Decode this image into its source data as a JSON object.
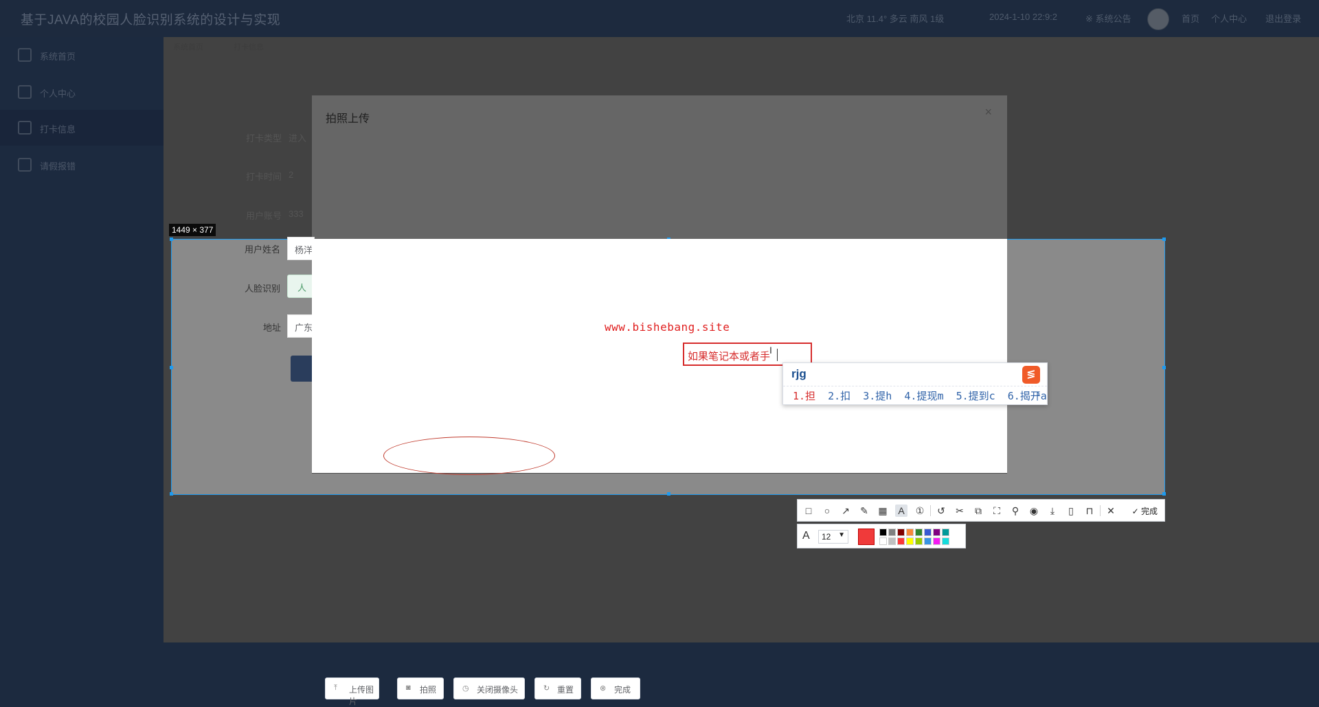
{
  "app": {
    "title": "基于JAVA的校园人脸识别系统的设计与实现",
    "weather": "北京  11.4°  多云  南风  1级",
    "datetime": "2024-1-10 22:9:2",
    "notice": "※ 系统公告",
    "nav": [
      "首页",
      "个人中心",
      "退出登录"
    ]
  },
  "sidebar": {
    "items": [
      {
        "label": "系统首页"
      },
      {
        "label": "个人中心"
      },
      {
        "label": "打卡信息"
      },
      {
        "label": "请假报错"
      }
    ]
  },
  "breadcrumb": {
    "items": [
      "系统首页",
      "打卡信息"
    ]
  },
  "form": {
    "rows": [
      {
        "label": "打卡类型",
        "value": "进入"
      },
      {
        "label": "打卡时间",
        "value": "2"
      },
      {
        "label": "用户账号",
        "value": "333"
      },
      {
        "label": "用户姓名",
        "value": "杨洋"
      },
      {
        "label": "人脸识别",
        "value": "人"
      },
      {
        "label": "地址",
        "value": "广东"
      }
    ]
  },
  "dialog": {
    "title": "拍照上传",
    "close_icon": "close-icon",
    "buttons": [
      {
        "label": "上传图片",
        "icon": "upload-icon"
      },
      {
        "label": "拍照",
        "icon": "camera-icon"
      },
      {
        "label": "关闭摄像头",
        "icon": "clock-icon"
      },
      {
        "label": "重置",
        "icon": "refresh-icon"
      },
      {
        "label": "完成",
        "icon": "check-circle-icon"
      }
    ]
  },
  "screenshot": {
    "size_label": "1449 × 377",
    "watermark": "www.bishebang.site",
    "text_annotation": "如果笔记本或者手"
  },
  "ime": {
    "composition": "rjg",
    "candidates": [
      "1.担",
      "2.扣",
      "3.提h",
      "4.提现m",
      "5.提到c",
      "6.揭开a"
    ]
  },
  "annotation_toolbar": {
    "tools": [
      "rectangle-icon",
      "ellipse-icon",
      "arrow-icon",
      "pen-icon",
      "mosaic-icon",
      "text-icon",
      "number-icon",
      "undo-icon",
      "scissors-icon",
      "ocr-icon",
      "scan-icon",
      "pin-icon",
      "record-icon",
      "download-icon",
      "save-icon",
      "bookmark-icon",
      "cancel-icon"
    ],
    "done_label": "完成",
    "font_size": "12",
    "current_color": "#f03a3a",
    "palette": [
      "#000000",
      "#808080",
      "#800000",
      "#f7883a",
      "#308430",
      "#385ad3",
      "#800080",
      "#009999",
      "#ffffff",
      "#c0c0c0",
      "#fb3838",
      "#ffff00",
      "#99cc00",
      "#3894e4",
      "#f31bf3",
      "#16dcdc"
    ]
  }
}
